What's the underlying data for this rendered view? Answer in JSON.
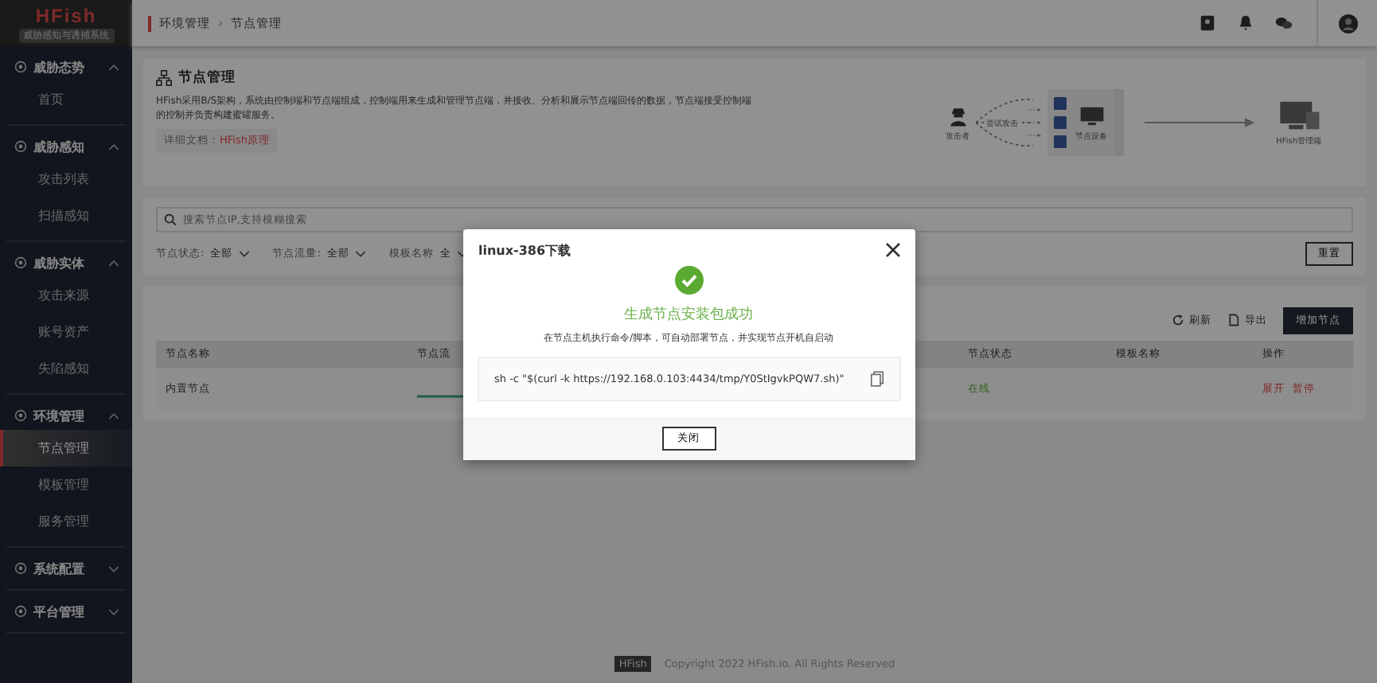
{
  "sidebar": {
    "logo": "HFish",
    "tagline": "威胁感知与诱捕系统",
    "groups": [
      {
        "title": "威胁态势",
        "expanded": true,
        "items": [
          {
            "label": "首页",
            "selected": false
          }
        ]
      },
      {
        "title": "威胁感知",
        "expanded": true,
        "items": [
          {
            "label": "攻击列表",
            "selected": false
          },
          {
            "label": "扫描感知",
            "selected": false
          }
        ]
      },
      {
        "title": "威胁实体",
        "expanded": true,
        "items": [
          {
            "label": "攻击来源",
            "selected": false
          },
          {
            "label": "账号资产",
            "selected": false
          },
          {
            "label": "失陷感知",
            "selected": false
          }
        ]
      },
      {
        "title": "环境管理",
        "expanded": true,
        "items": [
          {
            "label": "节点管理",
            "selected": true
          },
          {
            "label": "模板管理",
            "selected": false
          },
          {
            "label": "服务管理",
            "selected": false
          }
        ]
      },
      {
        "title": "系统配置",
        "expanded": false
      },
      {
        "title": "平台管理",
        "expanded": false
      }
    ]
  },
  "breadcrumb": {
    "items": [
      "环境管理",
      "节点管理"
    ],
    "separator": "›"
  },
  "intro": {
    "title": "节点管理",
    "description": "HFish采用B/S架构，系统由控制端和节点端组成，控制端用来生成和管理节点端，并接收、分析和展示节点端回传的数据，节点端接受控制端的控制并负责构建蜜罐服务。",
    "doc_label": "详细文档：",
    "doc_link": "HFish原理",
    "diagram": {
      "attacker": "攻击者",
      "attack": "尝试攻击",
      "node": "节点设备",
      "server": "HFish管理端"
    }
  },
  "filters": {
    "search": {
      "placeholder": "搜索节点IP,支持模糊搜索"
    },
    "selects": [
      {
        "label": "节点状态:",
        "value": "全部"
      },
      {
        "label": "节点流量:",
        "value": "全部"
      },
      {
        "label": "模板名称",
        "value": "全"
      }
    ],
    "reset": "重置"
  },
  "toolbar": {
    "refresh": "刷新",
    "export": "导出",
    "add": "增加节点"
  },
  "table": {
    "columns": [
      "节点名称",
      "节点流",
      "节点状态",
      "模板名称",
      "操作"
    ],
    "rows": [
      {
        "name": "内置节点",
        "status": "在线",
        "actions": [
          "展开",
          "暂停"
        ]
      }
    ]
  },
  "footer": {
    "badge": "HFish",
    "copyright": "Copyright 2022 HFish.io. All Rights Reserved"
  },
  "modal": {
    "title": "linux-386下载",
    "success": "生成节点安装包成功",
    "hint": "在节点主机执行命令/脚本，可自动部署节点，并实现节点开机自启动",
    "command": "sh -c \"$(curl -k https://192.168.0.103:4434/tmp/Y0StIgvkPQW7.sh)\"",
    "close": "关闭"
  }
}
